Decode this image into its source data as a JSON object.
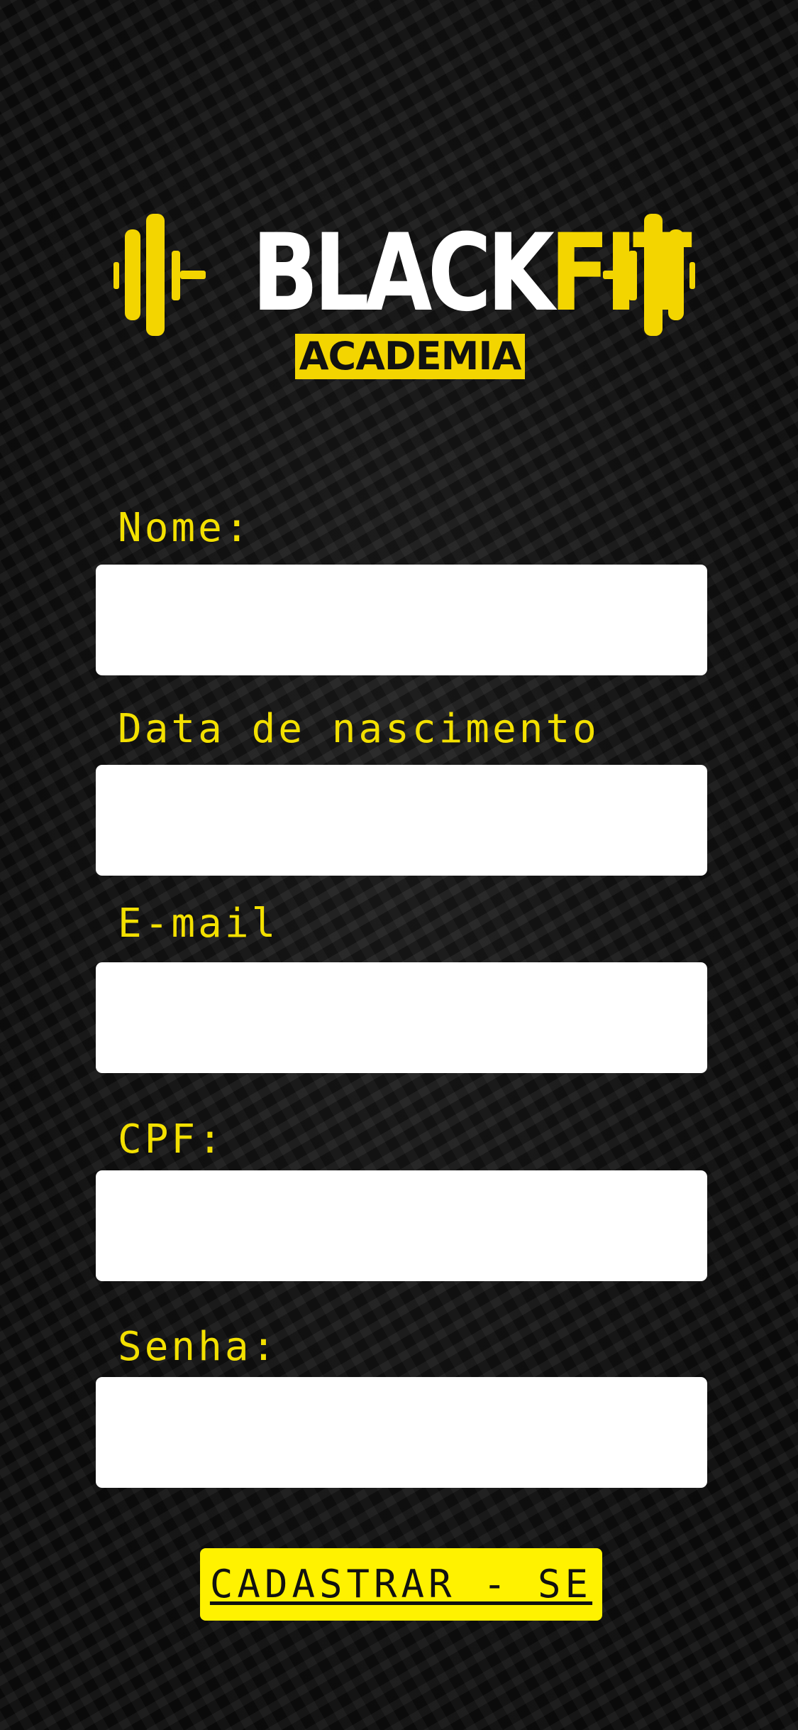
{
  "logo": {
    "brand_part1": "BLACK",
    "brand_part2": "FIT",
    "tagline": "ACADEMIA",
    "icon": "dumbbell-icon",
    "colors": {
      "accent": "#f3d500",
      "text": "#ffffff"
    }
  },
  "form": {
    "nome_label": "Nome:",
    "nome_value": "",
    "nascimento_label": "Data de nascimento",
    "nascimento_value": "",
    "email_label": "E-mail",
    "email_value": "",
    "cpf_label": "CPF:",
    "cpf_value": "",
    "senha_label": "Senha:",
    "senha_value": "",
    "submit_label": "CADASTRAR - SE"
  },
  "colors": {
    "background": "#121212",
    "label": "#f3e000",
    "button": "#fff200",
    "input": "#ffffff"
  }
}
